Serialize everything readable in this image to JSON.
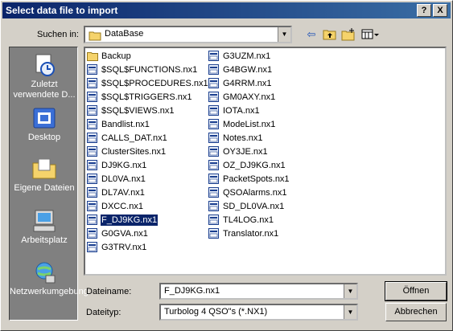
{
  "window": {
    "title": "Select data file to import",
    "help_label": "?",
    "close_label": "X"
  },
  "look_in": {
    "label": "Suchen in:",
    "value": "DataBase"
  },
  "places": [
    {
      "label": "Zuletzt verwendete D...",
      "icon": "recent-icon"
    },
    {
      "label": "Desktop",
      "icon": "desktop-icon"
    },
    {
      "label": "Eigene Dateien",
      "icon": "my-documents-icon"
    },
    {
      "label": "Arbeitsplatz",
      "icon": "my-computer-icon"
    },
    {
      "label": "Netzwerkumgebung",
      "icon": "network-icon"
    }
  ],
  "files_col1": [
    {
      "name": "Backup",
      "type": "folder"
    },
    {
      "name": "$SQL$FUNCTIONS.nx1",
      "type": "file"
    },
    {
      "name": "$SQL$PROCEDURES.nx1",
      "type": "file"
    },
    {
      "name": "$SQL$TRIGGERS.nx1",
      "type": "file"
    },
    {
      "name": "$SQL$VIEWS.nx1",
      "type": "file"
    },
    {
      "name": "Bandlist.nx1",
      "type": "file"
    },
    {
      "name": "CALLS_DAT.nx1",
      "type": "file"
    },
    {
      "name": "ClusterSites.nx1",
      "type": "file"
    },
    {
      "name": "DJ9KG.nx1",
      "type": "file"
    },
    {
      "name": "DL0VA.nx1",
      "type": "file"
    },
    {
      "name": "DL7AV.nx1",
      "type": "file"
    },
    {
      "name": "DXCC.nx1",
      "type": "file"
    },
    {
      "name": "F_DJ9KG.nx1",
      "type": "file",
      "selected": true
    },
    {
      "name": "G0GVA.nx1",
      "type": "file"
    },
    {
      "name": "G3TRV.nx1",
      "type": "file"
    }
  ],
  "files_col2": [
    {
      "name": "G3UZM.nx1",
      "type": "file"
    },
    {
      "name": "G4BGW.nx1",
      "type": "file"
    },
    {
      "name": "G4RRM.nx1",
      "type": "file"
    },
    {
      "name": "GM0AXY.nx1",
      "type": "file"
    },
    {
      "name": "IOTA.nx1",
      "type": "file"
    },
    {
      "name": "ModeList.nx1",
      "type": "file"
    },
    {
      "name": "Notes.nx1",
      "type": "file"
    },
    {
      "name": "OY3JE.nx1",
      "type": "file"
    },
    {
      "name": "OZ_DJ9KG.nx1",
      "type": "file"
    },
    {
      "name": "PacketSpots.nx1",
      "type": "file"
    },
    {
      "name": "QSOAlarms.nx1",
      "type": "file"
    },
    {
      "name": "SD_DL0VA.nx1",
      "type": "file"
    },
    {
      "name": "TL4LOG.nx1",
      "type": "file"
    },
    {
      "name": "Translator.nx1",
      "type": "file"
    }
  ],
  "filename": {
    "label": "Dateiname:",
    "value": "F_DJ9KG.nx1"
  },
  "filetype": {
    "label": "Dateityp:",
    "value": "Turbolog 4 QSO\"s (*.NX1)"
  },
  "buttons": {
    "open": "Öffnen",
    "cancel": "Abbrechen"
  },
  "colors": {
    "titlebar": "#0a246a",
    "selection": "#0a246a",
    "face": "#d4d0c8",
    "places_bg": "#808080"
  }
}
